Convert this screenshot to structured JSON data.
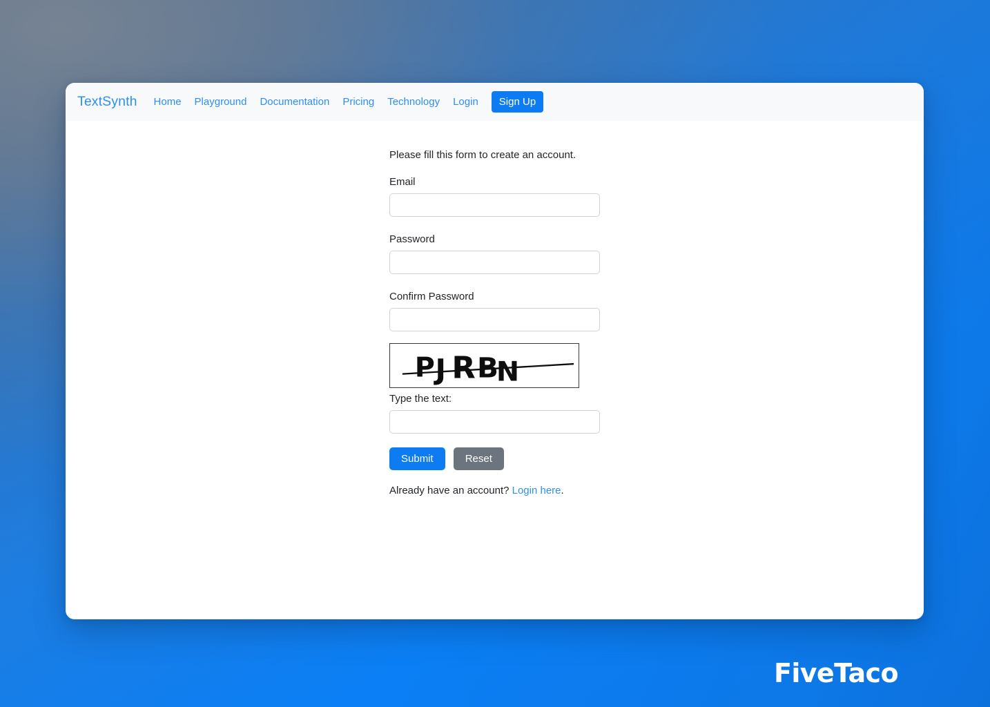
{
  "background": {
    "gradient_from": "#6c7c91",
    "gradient_to": "#0b7df2",
    "accent": "#0d7cf2"
  },
  "navbar": {
    "brand": "TextSynth",
    "links": [
      {
        "label": "Home"
      },
      {
        "label": "Playground"
      },
      {
        "label": "Documentation"
      },
      {
        "label": "Pricing"
      },
      {
        "label": "Technology"
      },
      {
        "label": "Login"
      }
    ],
    "signup_label": "Sign Up",
    "signup_color": "#0d7cf2",
    "link_color": "#2f8ef4",
    "background_color": "#f8f9fa"
  },
  "form": {
    "intro": "Please fill this form to create an account.",
    "fields": [
      {
        "label": "Email",
        "value": "",
        "placeholder": ""
      },
      {
        "label": "Password",
        "value": "",
        "placeholder": ""
      },
      {
        "label": "Confirm Password",
        "value": "",
        "placeholder": ""
      }
    ],
    "captcha": {
      "text": "PJRBN",
      "characters": [
        "P",
        "J",
        "R",
        "B",
        "N"
      ],
      "has_strikethrough_line": true,
      "border_color": "#3a3a3a",
      "background_color": "#ffffff"
    },
    "captcha_label": "Type the text:",
    "captcha_input_value": "",
    "captcha_input_placeholder": "",
    "submit_label": "Submit",
    "reset_label": "Reset",
    "submit_color": "#0d7cf2",
    "reset_color": "#6c757d",
    "login_prompt_prefix": "Already have an account? ",
    "login_link_label": "Login here",
    "login_prompt_suffix": "."
  },
  "watermark": {
    "text": "FiveTaco"
  }
}
